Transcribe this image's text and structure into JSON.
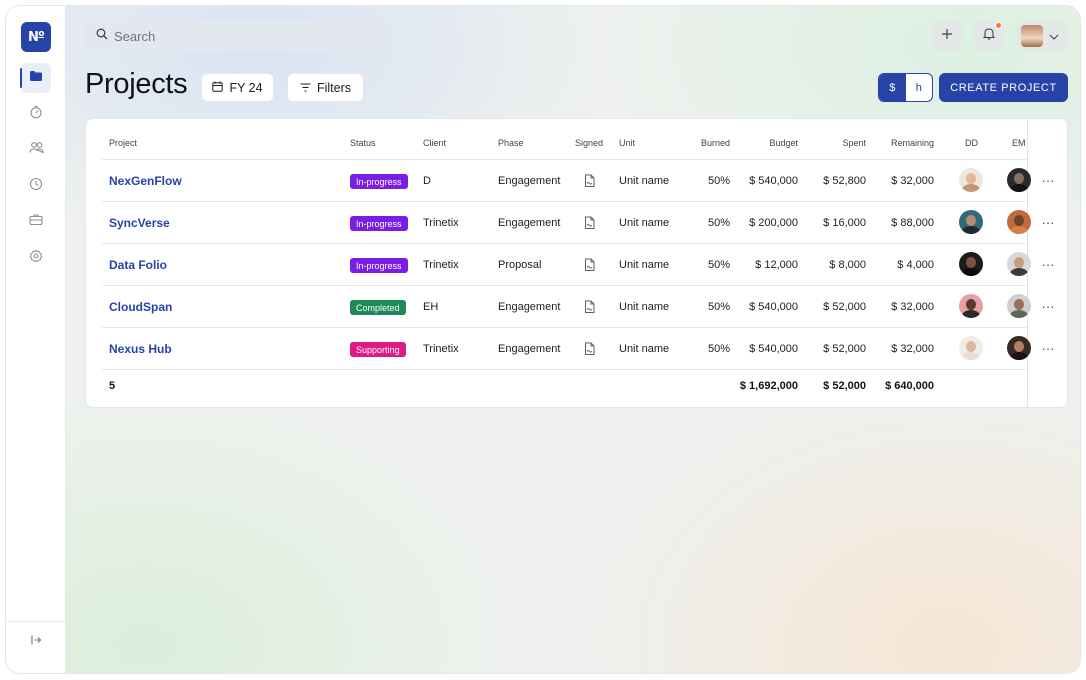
{
  "brand": {
    "logo_text": "N",
    "logo_suffix": "o"
  },
  "sidebar": {
    "items": [
      {
        "name": "projects",
        "icon": "folder-icon",
        "active": true
      },
      {
        "name": "timer",
        "icon": "timer-icon",
        "active": false
      },
      {
        "name": "people",
        "icon": "users-icon",
        "active": false
      },
      {
        "name": "history",
        "icon": "clock-icon",
        "active": false
      },
      {
        "name": "portfolio",
        "icon": "briefcase-icon",
        "active": false
      },
      {
        "name": "settings",
        "icon": "gear-icon",
        "active": false
      }
    ],
    "collapse_icon": "collapse-sidebar-icon"
  },
  "topbar": {
    "search_placeholder": "Search",
    "add_icon": "plus-icon",
    "notification_icon": "bell-icon",
    "has_notification": true,
    "user_menu_icon": "chevron-down-icon"
  },
  "page": {
    "title": "Projects",
    "fiscal_year": "FY 24",
    "filters_label": "Filters",
    "unit_toggle": {
      "options": [
        "$",
        "h"
      ],
      "selected": "$"
    },
    "create_label": "CREATE PROJECT"
  },
  "table": {
    "columns": {
      "project": "Project",
      "status": "Status",
      "client": "Client",
      "phase": "Phase",
      "signed": "Signed",
      "unit": "Unit",
      "burned": "Burned",
      "budget": "Budget",
      "spent": "Spent",
      "remaining": "Remaining",
      "dd": "DD",
      "em": "EM"
    },
    "rows": [
      {
        "project": "NexGenFlow",
        "status": "In-progress",
        "client": "D",
        "phase": "Engagement",
        "unit": "Unit name",
        "burned": "50%",
        "budget": "$ 540,000",
        "spent": "$ 52,800",
        "remaining": "$ 32,000"
      },
      {
        "project": "SyncVerse",
        "status": "In-progress",
        "client": "Trinetix",
        "phase": "Engagement",
        "unit": "Unit name",
        "burned": "50%",
        "budget": "$ 200,000",
        "spent": "$ 16,000",
        "remaining": "$ 88,000"
      },
      {
        "project": "Data Folio",
        "status": "In-progress",
        "client": "Trinetix",
        "phase": "Proposal",
        "unit": "Unit name",
        "burned": "50%",
        "budget": "$ 12,000",
        "spent": "$ 8,000",
        "remaining": "$ 4,000"
      },
      {
        "project": "CloudSpan",
        "status": "Completed",
        "client": "EH",
        "phase": "Engagement",
        "unit": "Unit name",
        "burned": "50%",
        "budget": "$ 540,000",
        "spent": "$ 52,000",
        "remaining": "$ 32,000"
      },
      {
        "project": "Nexus Hub",
        "status": "Supporting",
        "client": "Trinetix",
        "phase": "Engagement",
        "unit": "Unit name",
        "burned": "50%",
        "budget": "$ 540,000",
        "spent": "$ 52,000",
        "remaining": "$ 32,000"
      }
    ],
    "totals": {
      "count": "5",
      "budget": "$ 1,692,000",
      "spent": "$ 52,000",
      "remaining": "$ 640,000"
    }
  },
  "colors": {
    "accent": "#2743a8",
    "in_progress": "#7a1ee6",
    "completed": "#1f8a57",
    "supporting": "#dd1a86",
    "notification": "#f07d2f"
  }
}
